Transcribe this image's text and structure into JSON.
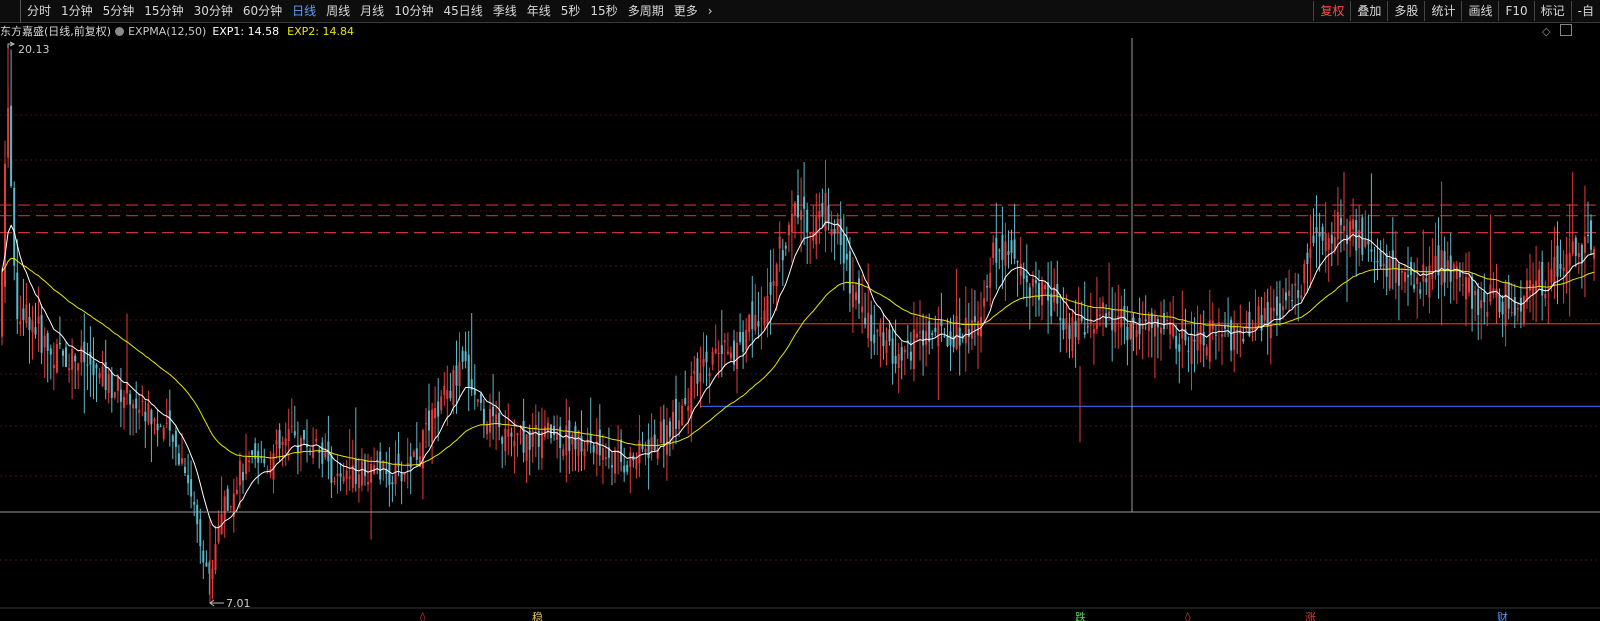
{
  "toolbar": {
    "tabs": [
      {
        "label": "分时",
        "active": false
      },
      {
        "label": "1分钟",
        "active": false
      },
      {
        "label": "5分钟",
        "active": false
      },
      {
        "label": "15分钟",
        "active": false
      },
      {
        "label": "30分钟",
        "active": false
      },
      {
        "label": "60分钟",
        "active": false
      },
      {
        "label": "日线",
        "active": true
      },
      {
        "label": "周线",
        "active": false
      },
      {
        "label": "月线",
        "active": false
      },
      {
        "label": "10分钟",
        "active": false
      },
      {
        "label": "45日线",
        "active": false
      },
      {
        "label": "季线",
        "active": false
      },
      {
        "label": "年线",
        "active": false
      },
      {
        "label": "5秒",
        "active": false
      },
      {
        "label": "15秒",
        "active": false
      },
      {
        "label": "多周期",
        "active": false
      },
      {
        "label": "更多",
        "active": false
      }
    ],
    "tools": [
      {
        "label": "复权",
        "active": true
      },
      {
        "label": "叠加",
        "active": false
      },
      {
        "label": "多股",
        "active": false
      },
      {
        "label": "统计",
        "active": false
      },
      {
        "label": "画线",
        "active": false
      },
      {
        "label": "F10",
        "active": false
      },
      {
        "label": "标记",
        "active": false
      },
      {
        "label": "-自",
        "active": false
      }
    ]
  },
  "legend": {
    "stock": "东方嘉盛(日线,前复权)",
    "indicator": "EXPMA(12,50)",
    "exp1": "EXP1: 14.58",
    "exp2": "EXP2: 14.84"
  },
  "colors": {
    "up": "#e23b3b",
    "down": "#5fb8c9",
    "exp1": "#ffffff",
    "exp2": "#e6e600",
    "hline": "#c83232",
    "blueline": "#3a5bd0"
  },
  "chart_data": {
    "type": "candlestick",
    "price_range": [
      7.01,
      20.13
    ],
    "high_label": "20.13",
    "low_label": "7.01",
    "horizontal_lines": [
      16.4,
      16.15,
      15.75,
      13.6
    ],
    "support_line": 11.65,
    "overlay_series": [
      "EXP1",
      "EXP2"
    ],
    "event_markers": [
      {
        "label": "◊",
        "color": "#e23b3b"
      },
      {
        "label": "稳",
        "color": "#e6c060"
      },
      {
        "label": "跌",
        "color": "#5fd05f"
      },
      {
        "label": "◊",
        "color": "#e23b3b"
      },
      {
        "label": "涨",
        "color": "#e23b3b"
      },
      {
        "label": "财",
        "color": "#4aa0ff"
      }
    ]
  }
}
